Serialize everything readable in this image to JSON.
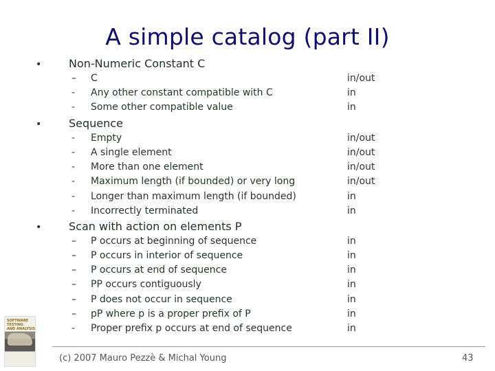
{
  "slide": {
    "title": "A simple catalog (part II)",
    "bullet_glyph": "•",
    "sections": [
      {
        "heading": "Non-Numeric Constant C",
        "items": [
          {
            "dash": "–",
            "text": "C",
            "value": "in/out"
          },
          {
            "dash": "-",
            "text": "Any other constant compatible with C",
            "value": "in"
          },
          {
            "dash": "-",
            "text": "Some other compatible value",
            "value": "in"
          }
        ]
      },
      {
        "heading": "Sequence",
        "items": [
          {
            "dash": "-",
            "text": "Empty",
            "value": "in/out"
          },
          {
            "dash": "-",
            "text": "A single element",
            "value": "in/out"
          },
          {
            "dash": "-",
            "text": "More than one element",
            "value": "in/out"
          },
          {
            "dash": "-",
            "text": "Maximum length (if bounded) or very long",
            "value": "in/out"
          },
          {
            "dash": "-",
            "text": "Longer than maximum length (if bounded)",
            "value": "in"
          },
          {
            "dash": "-",
            "text": "Incorrectly terminated",
            "value": "in"
          }
        ]
      },
      {
        "heading": "Scan with action on elements P",
        "items": [
          {
            "dash": "–",
            "text": "P occurs at beginning of sequence",
            "value": "in"
          },
          {
            "dash": "–",
            "text": "P occurs in interior of sequence",
            "value": "in"
          },
          {
            "dash": "–",
            "text": "P occurs at end of sequence",
            "value": "in"
          },
          {
            "dash": "–",
            "text": "PP occurs contiguously",
            "value": "in"
          },
          {
            "dash": "–",
            "text": "P does not occur in sequence",
            "value": "in"
          },
          {
            "dash": "–",
            "text": "pP where p is a proper prefix of P",
            "value": "in"
          },
          {
            "dash": "-",
            "text": "Proper prefix p occurs at end of sequence",
            "value": "in"
          }
        ]
      }
    ]
  },
  "book_cover": {
    "title_line1": "SOFTWARE TESTING",
    "title_line2": "AND ANALYSIS"
  },
  "footer": {
    "copyright": "(c) 2007 Mauro Pezzè & Michal Young",
    "page_number": "43"
  }
}
